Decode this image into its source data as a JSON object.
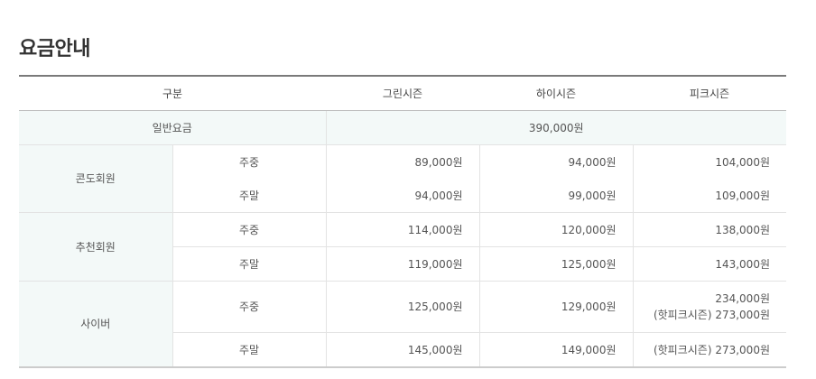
{
  "title": "요금안내",
  "headers": {
    "category": "구분",
    "green": "그린시즌",
    "high": "하이시즌",
    "peak": "피크시즌"
  },
  "general": {
    "label": "일반요금",
    "price": "390,000원"
  },
  "groups": {
    "condo": {
      "label": "콘도회원",
      "weekday": {
        "day": "주중",
        "green": "89,000원",
        "high": "94,000원",
        "peak": "104,000원"
      },
      "weekend": {
        "day": "주말",
        "green": "94,000원",
        "high": "99,000원",
        "peak": "109,000원"
      }
    },
    "referral": {
      "label": "추천회원",
      "weekday": {
        "day": "주중",
        "green": "114,000원",
        "high": "120,000원",
        "peak": "138,000원"
      },
      "weekend": {
        "day": "주말",
        "green": "119,000원",
        "high": "125,000원",
        "peak": "143,000원"
      }
    },
    "cyber": {
      "label": "사이버",
      "weekday": {
        "day": "주중",
        "green": "125,000원",
        "high": "129,000원",
        "peak_line1": "234,000원",
        "peak_line2": "(핫피크시즌) 273,000원"
      },
      "weekend": {
        "day": "주말",
        "green": "145,000원",
        "high": "149,000원",
        "peak": "(핫피크시즌) 273,000원"
      }
    }
  }
}
